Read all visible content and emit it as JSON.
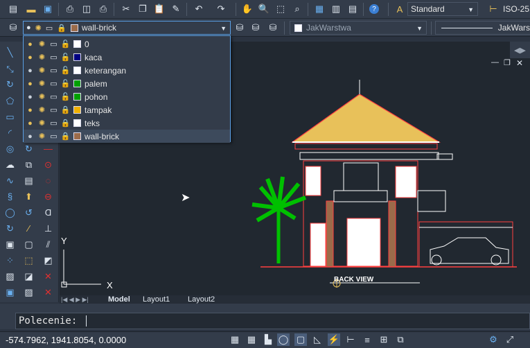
{
  "toolbar": {
    "text_style": "Standard",
    "dim_style": "ISO-25"
  },
  "layers_toolbar": {
    "current_layer": "wall-brick",
    "current_swatch": "#9b6b4a",
    "layer_filter": "JakWarstwa",
    "linetype": "JakWars"
  },
  "layers": [
    {
      "name": "0",
      "color": "#ffffff",
      "on": true,
      "frozen": false,
      "locked": false
    },
    {
      "name": "kaca",
      "color": "#000080",
      "on": true,
      "frozen": false,
      "locked": false
    },
    {
      "name": "keterangan",
      "color": "#ffffff",
      "on": false,
      "frozen": false,
      "locked": false
    },
    {
      "name": "palem",
      "color": "#00a000",
      "on": true,
      "frozen": false,
      "locked": false
    },
    {
      "name": "pohon",
      "color": "#00a000",
      "on": false,
      "frozen": false,
      "locked": false
    },
    {
      "name": "tampak",
      "color": "#f0b000",
      "on": true,
      "frozen": false,
      "locked": true
    },
    {
      "name": "teks",
      "color": "#ffffff",
      "on": true,
      "frozen": false,
      "locked": true
    },
    {
      "name": "wall-brick",
      "color": "#9b6b4a",
      "on": false,
      "frozen": false,
      "locked": true
    }
  ],
  "drawing": {
    "label": "BACK VIEW",
    "axis_x": "X",
    "axis_y": "Y"
  },
  "layout_tabs": [
    "Model",
    "Layout1",
    "Layout2"
  ],
  "command": {
    "prompt": "Polecenie:"
  },
  "status": {
    "coords": "-574.7962, 1941.8054, 0.0000"
  }
}
